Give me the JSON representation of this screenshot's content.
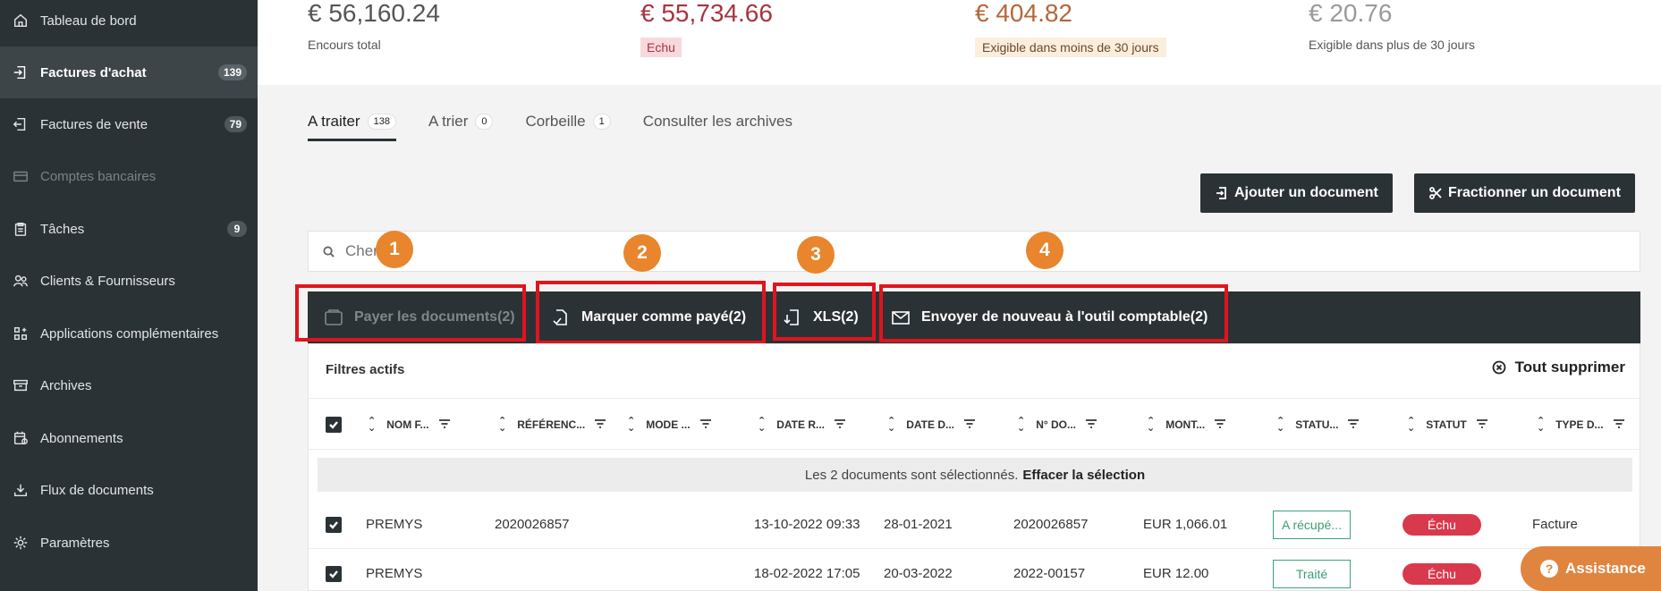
{
  "sidebar": {
    "items": [
      {
        "label": "Tableau de bord",
        "icon": "home-icon"
      },
      {
        "label": "Factures d'achat",
        "icon": "import-icon",
        "badge": "139",
        "active": true
      },
      {
        "label": "Factures de vente",
        "icon": "export-icon",
        "badge": "79"
      },
      {
        "label": "Comptes bancaires",
        "icon": "card-icon",
        "disabled": true
      },
      {
        "label": "Tâches",
        "icon": "clipboard-icon",
        "badge": "9"
      },
      {
        "label": "Clients & Fournisseurs",
        "icon": "users-icon"
      },
      {
        "label": "Applications complémentaires",
        "icon": "apps-icon"
      },
      {
        "label": "Archives",
        "icon": "archive-icon"
      },
      {
        "label": "Abonnements",
        "icon": "calendar-icon"
      },
      {
        "label": "Flux de documents",
        "icon": "download-icon"
      },
      {
        "label": "Paramètres",
        "icon": "gear-icon"
      }
    ]
  },
  "kpis": [
    {
      "value": "€ 56,160.24",
      "label": "Encours total",
      "color": "#555555"
    },
    {
      "value": "€ 55,734.66",
      "label": "Echu",
      "color": "#a8343f"
    },
    {
      "value": "€ 404.82",
      "label": "Exigible dans moins de 30 jours",
      "color": "#b5673a"
    },
    {
      "value": "€ 20.76",
      "label": "Exigible dans plus de 30 jours",
      "color": "#9a9a9a"
    }
  ],
  "tabs": [
    {
      "label": "A traiter",
      "count": "138",
      "active": true
    },
    {
      "label": "A trier",
      "count": "0"
    },
    {
      "label": "Corbeille",
      "count": "1"
    },
    {
      "label": "Consulter les archives"
    }
  ],
  "actions": {
    "add_document": "Ajouter un document",
    "split_document": "Fractionner un document"
  },
  "search": {
    "placeholder": "Chercher"
  },
  "bulk": {
    "pay": "Payer les documents(2)",
    "mark_paid": "Marquer comme payé(2)",
    "xls": "XLS(2)",
    "resend": "Envoyer de nouveau à l'outil comptable(2)"
  },
  "markers": [
    "1",
    "2",
    "3",
    "4"
  ],
  "table": {
    "active_filters": "Filtres actifs",
    "clear_all": "Tout supprimer",
    "columns": [
      "NOM F...",
      "RÉFÉRENC...",
      "MODE ...",
      "DATE R...",
      "DATE D...",
      "N° DO...",
      "MONT...",
      "STATU...",
      "STATUT",
      "TYPE D..."
    ],
    "selection_text": "Les 2 documents sont sélectionnés.",
    "selection_clear": "Effacer la sélection",
    "rows": [
      {
        "name": "PREMYS",
        "reference": "2020026857",
        "mode": "",
        "date_r": "13-10-2022 09:33",
        "date_d": "28-01-2021",
        "doc_no": "2020026857",
        "amount": "EUR 1,066.01",
        "status1": "A récupé...",
        "status2": "Échu",
        "type": "Facture"
      },
      {
        "name": "PREMYS",
        "reference": "",
        "mode": "",
        "date_r": "18-02-2022 17:05",
        "date_d": "20-03-2022",
        "doc_no": "2022-00157",
        "amount": "EUR 12.00",
        "status1": "Traité",
        "status2": "Échu",
        "type": ""
      }
    ]
  },
  "assistance": {
    "label": "Assistance",
    "icon_glyph": "?"
  }
}
